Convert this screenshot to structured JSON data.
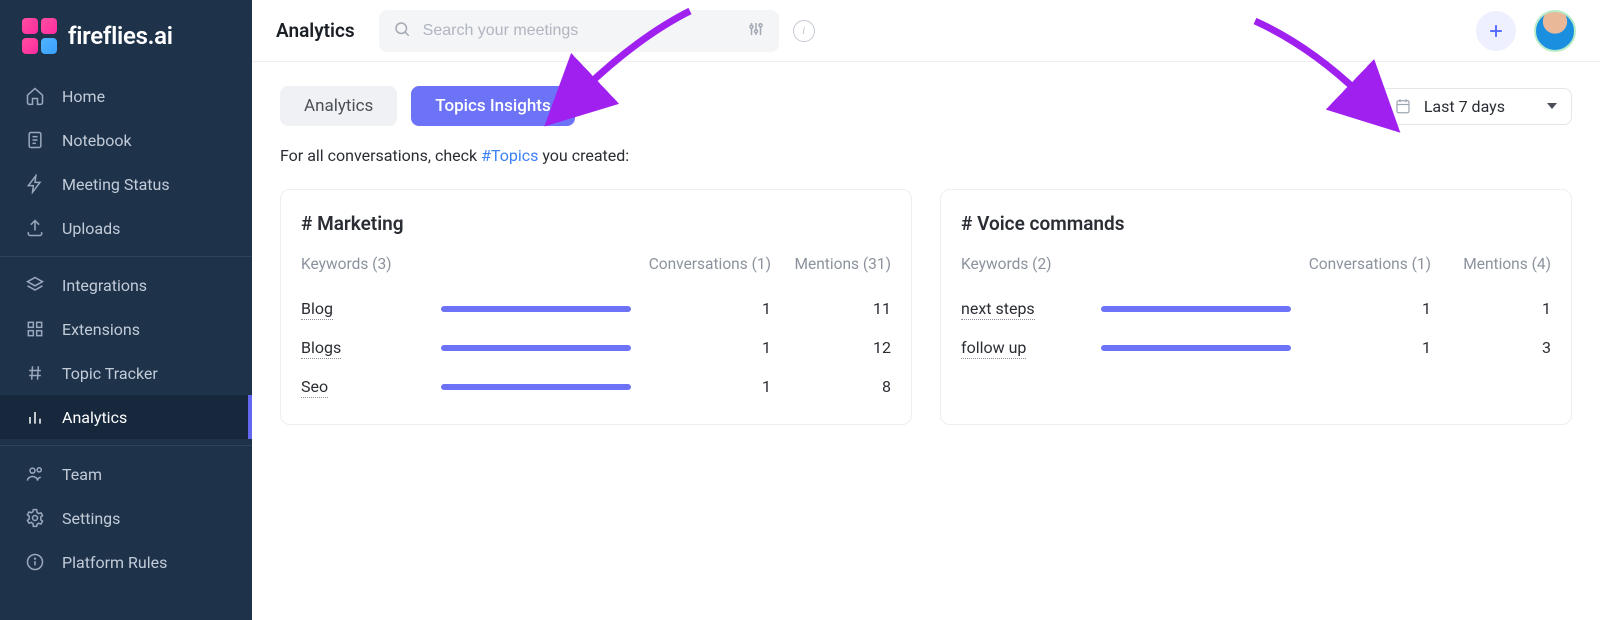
{
  "brand": "fireflies.ai",
  "header": {
    "title": "Analytics",
    "search_placeholder": "Search your meetings",
    "date_label": "Last 7 days"
  },
  "sidebar": {
    "groups": [
      [
        {
          "icon": "home",
          "label": "Home"
        },
        {
          "icon": "notebook",
          "label": "Notebook"
        },
        {
          "icon": "status",
          "label": "Meeting Status"
        },
        {
          "icon": "upload",
          "label": "Uploads"
        }
      ],
      [
        {
          "icon": "integrations",
          "label": "Integrations"
        },
        {
          "icon": "extensions",
          "label": "Extensions"
        },
        {
          "icon": "hash",
          "label": "Topic Tracker"
        },
        {
          "icon": "analytics",
          "label": "Analytics",
          "active": true
        }
      ],
      [
        {
          "icon": "team",
          "label": "Team"
        },
        {
          "icon": "settings",
          "label": "Settings"
        },
        {
          "icon": "info",
          "label": "Platform Rules"
        }
      ]
    ]
  },
  "tabs": {
    "analytics": "Analytics",
    "topics_insights": "Topics Insights"
  },
  "subtext": {
    "prefix": "For all conversations, check ",
    "link": "#Topics",
    "suffix": " you created:"
  },
  "cards": [
    {
      "title": "# Marketing",
      "kw_header": "Keywords (3)",
      "conv_header": "Conversations (1)",
      "ment_header": "Mentions (31)",
      "rows": [
        {
          "kw": "Blog",
          "conv": 1,
          "ment": 11,
          "bar_pct": 100
        },
        {
          "kw": "Blogs",
          "conv": 1,
          "ment": 12,
          "bar_pct": 100
        },
        {
          "kw": "Seo",
          "conv": 1,
          "ment": 8,
          "bar_pct": 100
        }
      ]
    },
    {
      "title": "# Voice commands",
      "kw_header": "Keywords (2)",
      "conv_header": "Conversations (1)",
      "ment_header": "Mentions (4)",
      "rows": [
        {
          "kw": "next steps",
          "conv": 1,
          "ment": 1,
          "bar_pct": 100
        },
        {
          "kw": "follow up",
          "conv": 1,
          "ment": 3,
          "bar_pct": 100
        }
      ]
    }
  ]
}
